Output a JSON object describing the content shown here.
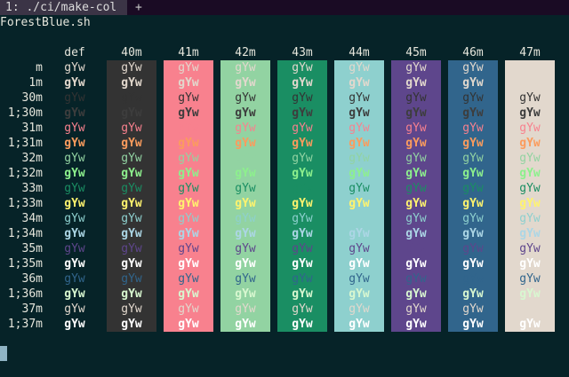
{
  "tab": {
    "label": "1: ./ci/make-col",
    "add_label": "+"
  },
  "script_name": "ForestBlue.sh",
  "sample_text": "gYw",
  "columns": [
    "def",
    "40m",
    "41m",
    "42m",
    "43m",
    "44m",
    "45m",
    "46m",
    "47m"
  ],
  "column_backgrounds": [
    null,
    "#333333",
    "#f8818e",
    "#92d3a2",
    "#1a8e63",
    "#8ed0ce",
    "#5e468c",
    "#31658c",
    "#e2d8cd"
  ],
  "rows": [
    "m",
    "1m",
    "30m",
    "1;30m",
    "31m",
    "1;31m",
    "32m",
    "1;32m",
    "33m",
    "1;33m",
    "34m",
    "1;34m",
    "35m",
    "1;35m",
    "36m",
    "1;36m",
    "37m",
    "1;37m"
  ],
  "row_colors": [
    "#e2d8cd",
    "#e2d8cd",
    "#333333",
    "#3d3d3d",
    "#f8818e",
    "#fb9c5d",
    "#92d3a2",
    "#8df08d",
    "#1a8e63",
    "#fff36e",
    "#8ed0ce",
    "#acd6e5",
    "#5e468c",
    "#ffffff",
    "#31658c",
    "#d8f7d0",
    "#e2d8cd",
    "#ffffff"
  ]
}
